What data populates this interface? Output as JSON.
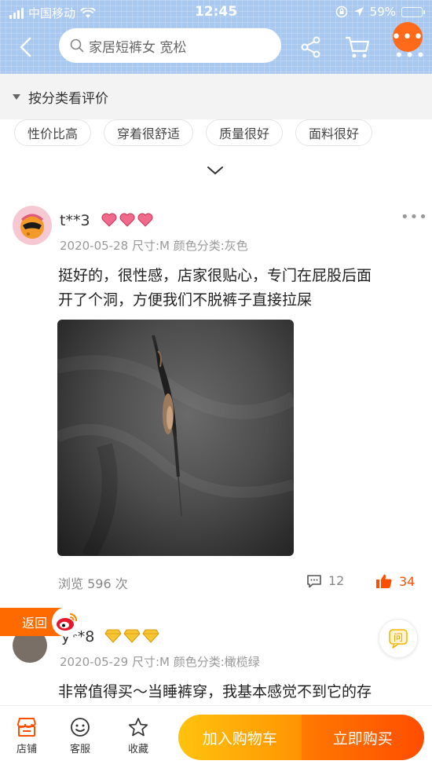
{
  "status_bar": {
    "carrier": "中国移动",
    "time": "12:45",
    "battery": "59%",
    "battery_level": 0.59
  },
  "header": {
    "search_text": "家居短裤女 宽松",
    "more_badge": "•••"
  },
  "filter": {
    "label": "按分类看评价",
    "tags": [
      "性价比高",
      "穿着很舒适",
      "质量很好",
      "面料很好"
    ]
  },
  "reviews": [
    {
      "user": "t**3",
      "level_icon": "heart-icon",
      "level_count": 3,
      "meta": "2020-05-28 尺寸:M 颜色分类:灰色",
      "text_line1": "挺好的，很性感，店家很贴心，专门在屁股后面",
      "text_line2": "开了个洞，方便我们不脱裤子直接拉屎",
      "views": "浏览 596 次",
      "comments": "12",
      "likes": "34"
    },
    {
      "user": "y**8",
      "level_icon": "diamond-icon",
      "level_count": 3,
      "meta": "2020-05-29 尺寸:M 颜色分类:橄榄绿",
      "text": "非常值得买～当睡裤穿，我基本感觉不到它的存"
    }
  ],
  "floating": {
    "back_label": "返回",
    "ask_label": "问"
  },
  "bottom_bar": {
    "store": "店铺",
    "service": "客服",
    "favorite": "收藏",
    "add_to_cart": "加入购物车",
    "buy_now": "立即购买"
  },
  "colors": {
    "header_bg": "#a9c8ef",
    "accent": "#ff5000",
    "cart_button": "#ffa300",
    "buy_button": "#ff5a00"
  }
}
